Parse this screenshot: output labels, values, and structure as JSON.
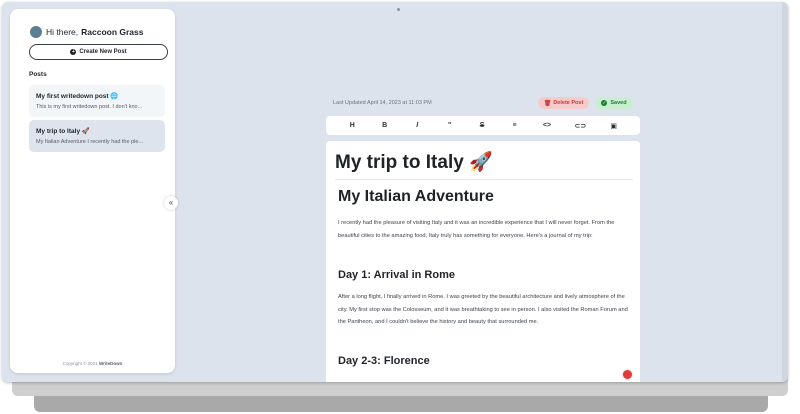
{
  "sidebar": {
    "greeting": "Hi there,",
    "user_name": "Raccoon Grass",
    "new_post_label": "Create New Post",
    "posts_heading": "Posts",
    "posts": [
      {
        "title": "My first writedown post 🌐",
        "excerpt": "This is my first writedown post. I don't kno..."
      },
      {
        "title": "My trip to Italy 🚀",
        "excerpt": "My Italian Adventure I recently had the ple..."
      }
    ],
    "footer_prefix": "Copyright © 2021",
    "footer_brand": "WriteDown",
    "collapse_icon": "«"
  },
  "topbar": {
    "last_updated": "Last Updated April 14, 2023 at 11:03 PM",
    "delete_label": "Delete Post",
    "saved_label": "Saved"
  },
  "toolbar": {
    "tools": [
      "H",
      "B",
      "I",
      "\"",
      "S",
      "≡",
      "<>",
      "⊂⊃",
      "▣"
    ]
  },
  "editor": {
    "title": "My trip to Italy 🚀",
    "heading1": "My Italian Adventure",
    "para1": "I recently had the pleasure of visiting Italy and it was an incredible experience that I will never forget. From the beautiful cities to the amazing food, Italy truly has something for everyone. Here's a journal of my trip:",
    "heading2": "Day 1: Arrival in Rome",
    "para2": "After a long flight, I finally arrived in Rome. I was greeted by the beautiful architecture and lively atmosphere of the city. My first stop was the Colosseum, and it was breathtaking to see in person. I also visited the Roman Forum and the Pantheon, and I couldn't believe the history and beauty that surrounded me.",
    "heading3": "Day 2-3: Florence"
  }
}
